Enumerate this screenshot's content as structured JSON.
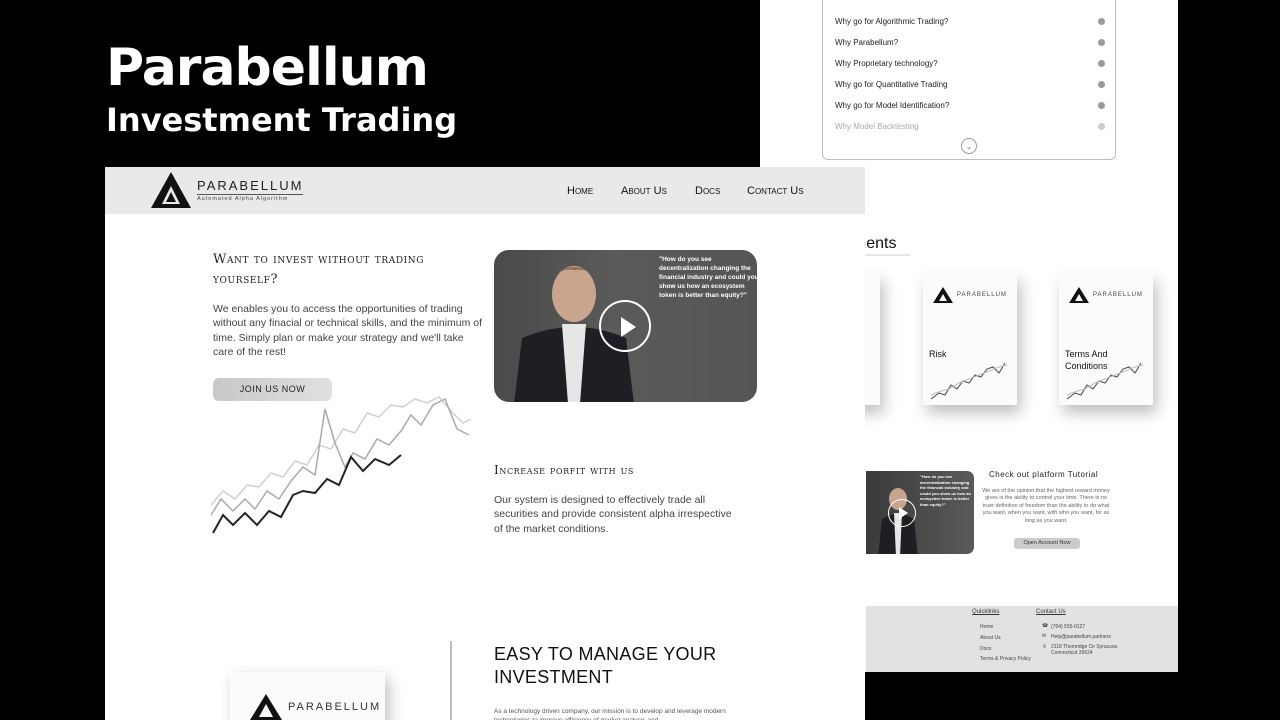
{
  "hero": {
    "title": "Parabellum",
    "subtitle": "Investment Trading"
  },
  "back": {
    "faq": [
      "Why go for Algorithmic Trading?",
      "Why Parabellum?",
      "Why Proprietary technology?",
      "Why go for Quantitative Trading",
      "Why go for Model Identification?",
      "Why Model Backtesting"
    ],
    "docs_heading_partial": "uments",
    "doc_cards": [
      {
        "title": "Risk"
      },
      {
        "title": "Terms And Conditions"
      }
    ],
    "logo_name": "PARABELLUM",
    "tutorial": {
      "title": "Check out platform Tutorial",
      "body": "We are of the opinion that the highest reward money gives is the ability to control your time. There is no truer definition of freedom than the ability to do what you want, when you want, with who you want, for as long as you want.",
      "button": "Open Account Now",
      "quote": "\"How do you see decentralization changing the financial industry and could you show us how an ecosystem token is better than equity?\""
    },
    "footer": {
      "quicklinks_title": "Quicklinks",
      "links": [
        "Home",
        "About Us",
        "Docs",
        "Terms & Privacy Policy"
      ],
      "contact_title": "Contact Us",
      "phone": "(704) 555-0127",
      "email": "Help@parabellum.partners",
      "address": "2118 Thornridge Cir Syracuse, Connecticut 35624"
    }
  },
  "front": {
    "logo": {
      "name": "PARABELLUM",
      "tagline": "Automated Alpha Algorithm"
    },
    "nav": [
      "Home",
      "About Us",
      "Docs",
      "Contact Us"
    ],
    "hero_heading": "Want to invest without trading yourself?",
    "hero_text": "We enables you to access the opportunities of trading without any finacial or technical skills, and the minimum of time. Simply plan or make your strategy and we'll take care of the rest!",
    "join_button": "JOIN US NOW",
    "video_quote": "\"How do you see decentralization changing the financial industry and could you show us how an ecosystem token is better than equity?\"",
    "profit_heading": "Increase porfit with us",
    "profit_text": "Our system is designed to effectively trade all securities and provide consistent alpha irrespective of the market conditions.",
    "manage_heading": "EASY TO MANAGE YOUR INVESTMENT",
    "manage_text": "As a technology driven company, our mission is to develop and leverage modern technologies to improve efficiency of market analysis and",
    "book_logo": "PARABELLUM"
  }
}
